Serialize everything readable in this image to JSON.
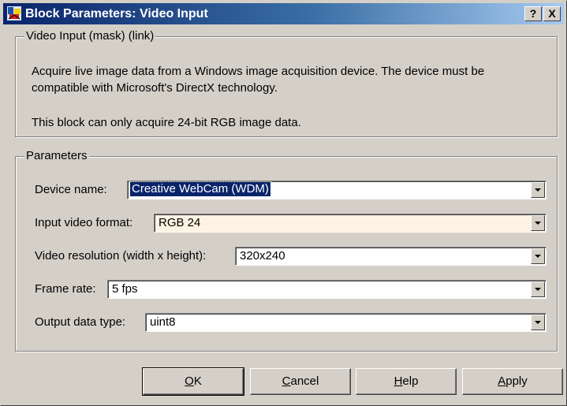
{
  "window": {
    "title": "Block Parameters: Video Input"
  },
  "titlebar_buttons": {
    "help": "?",
    "close": "X"
  },
  "description_group": {
    "label": "Video Input (mask) (link)",
    "line1": "Acquire live image data from a Windows image acquisition device. The device must be",
    "line2": "compatible with Microsoft's DirectX technology.",
    "line3": "This block can only acquire 24-bit RGB image data."
  },
  "parameters_group": {
    "label": "Parameters",
    "device_name": {
      "label": "Device name:",
      "value": "Creative WebCam (WDM)"
    },
    "input_video_format": {
      "label": "Input video format:",
      "value": "RGB 24"
    },
    "video_resolution": {
      "label": "Video resolution (width x height):",
      "value": "320x240"
    },
    "frame_rate": {
      "label": "Frame rate:",
      "value": "5 fps"
    },
    "output_data_type": {
      "label": "Output data type:",
      "value": "uint8"
    }
  },
  "buttons": {
    "ok": {
      "mnemonic": "O",
      "rest": "K"
    },
    "cancel": {
      "mnemonic": "C",
      "rest": "ancel"
    },
    "help": {
      "mnemonic": "H",
      "rest": "elp"
    },
    "apply": {
      "mnemonic": "A",
      "rest": "pply"
    }
  },
  "icons": {
    "title_icon": "simulink-block-icon",
    "dropdown": "dropdown-arrow-icon"
  },
  "colors": {
    "title_active": "#0a246a",
    "face": "#d4d0c8",
    "selection": "#0a246a",
    "highlighted_field": "#fdf2e3"
  }
}
